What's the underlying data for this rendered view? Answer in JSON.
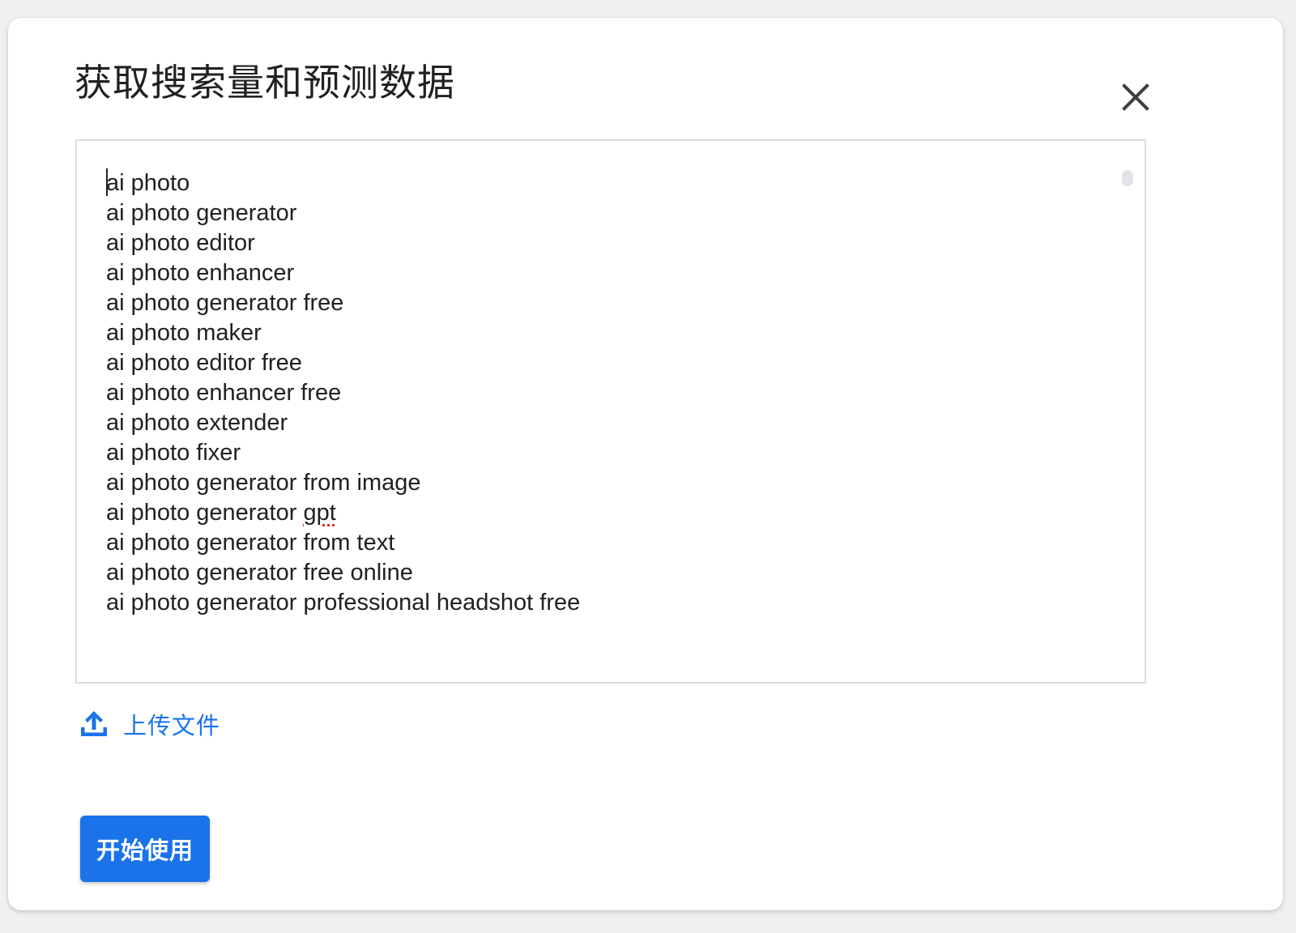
{
  "dialog": {
    "title": "获取搜索量和预测数据",
    "close_icon": "close-icon"
  },
  "keywords_input": {
    "lines": [
      "ai photo",
      "ai photo generator",
      "ai photo editor",
      "ai photo enhancer",
      "ai photo generator free",
      "ai photo maker",
      "ai photo editor free",
      "ai photo enhancer free",
      "ai photo extender",
      "ai photo fixer",
      "ai photo generator from image",
      "ai photo generator gpt",
      "ai photo generator from text",
      "ai photo generator free online",
      "ai photo generator professional headshot free"
    ],
    "misspelled_word": "gpt"
  },
  "upload": {
    "icon": "upload-icon",
    "label": "上传文件"
  },
  "actions": {
    "start_label": "开始使用"
  },
  "colors": {
    "accent": "#1a73e8",
    "text": "#202124",
    "border": "#dadce0",
    "spellcheck": "#d93025"
  }
}
